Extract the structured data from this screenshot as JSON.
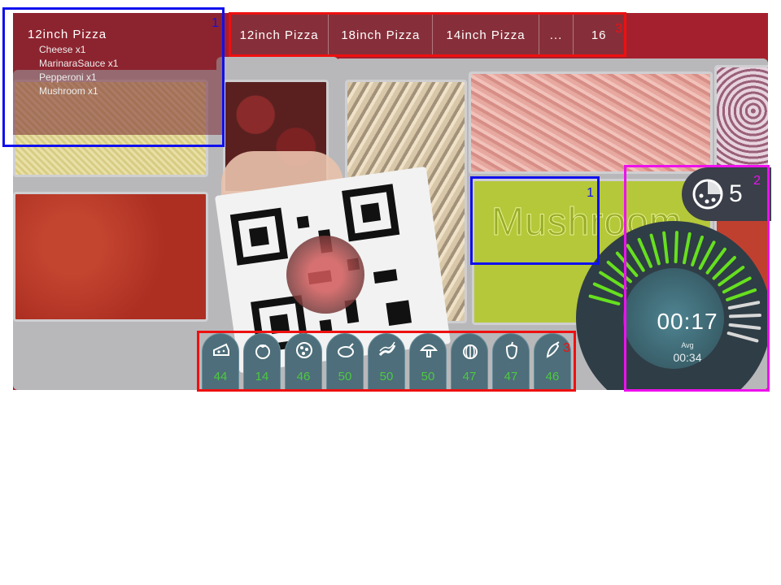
{
  "current_order": {
    "title": "12inch Pizza",
    "items": [
      "Cheese x1",
      "MarinaraSauce x1",
      "Pepperoni x1",
      "Mushroom x1"
    ]
  },
  "order_queue": {
    "tabs": [
      "12inch Pizza",
      "18inch Pizza",
      "14inch Pizza",
      "...",
      "16"
    ]
  },
  "bin_label": "Mushroom",
  "ingredients": [
    {
      "icon": "cheese-icon",
      "count": "44"
    },
    {
      "icon": "tomato-icon",
      "count": "14"
    },
    {
      "icon": "pepperoni-icon",
      "count": "46"
    },
    {
      "icon": "chicken-icon",
      "count": "50"
    },
    {
      "icon": "bacon-icon",
      "count": "50"
    },
    {
      "icon": "mushroom-icon",
      "count": "50"
    },
    {
      "icon": "onion-icon",
      "count": "47"
    },
    {
      "icon": "pepper-icon",
      "count": "47"
    },
    {
      "icon": "chili-icon",
      "count": "46"
    }
  ],
  "timer": {
    "time": "00:17",
    "avg_label": "Avg",
    "avg_time": "00:34",
    "progress_fraction": 0.8,
    "active_color": "#66e01e",
    "inactive_color": "#d8d8d8"
  },
  "pizza_count": {
    "icon": "pizza-icon",
    "value": "5"
  },
  "annotations": [
    {
      "label": "1",
      "color": "#1010ee"
    },
    {
      "label": "3",
      "color": "#ee1010"
    },
    {
      "label": "1",
      "color": "#1010ee"
    },
    {
      "label": "2",
      "color": "#ee10ee"
    },
    {
      "label": "3",
      "color": "#ee1010"
    }
  ]
}
